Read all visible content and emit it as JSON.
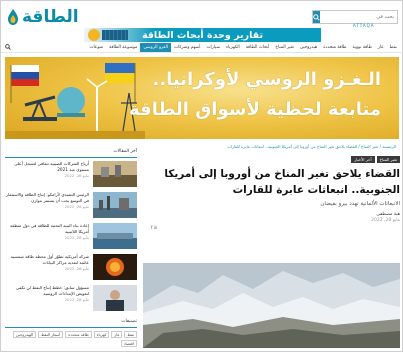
{
  "header": {
    "logo_text": "الطاقة",
    "logo_sub": "ATTAQA",
    "search_placeholder": "بحث في"
  },
  "promo": {
    "text": "تقارير وحدة أبحاث الطاقة"
  },
  "nav": {
    "items": [
      {
        "label": "نفط",
        "active": false
      },
      {
        "label": "غاز",
        "active": false
      },
      {
        "label": "طاقة نووية",
        "active": false
      },
      {
        "label": "طاقة متجددة",
        "active": false
      },
      {
        "label": "هيدروجين",
        "active": false
      },
      {
        "label": "تغير المناخ",
        "active": false
      },
      {
        "label": "أبحاث الطاقة",
        "active": false
      },
      {
        "label": "الكهرباء",
        "active": false
      },
      {
        "label": "سيارات",
        "active": false
      },
      {
        "label": "أسهم وشركات",
        "active": false
      },
      {
        "label": "الغزو الروسي",
        "active": true
      },
      {
        "label": "موسوعة الطاقة",
        "active": false
      },
      {
        "label": "منوعات",
        "active": false
      }
    ]
  },
  "hero": {
    "line1": "الـغـزو الروسي لأوكرانيا..",
    "line2": "متابعة لحظية لأسواق الطاقة"
  },
  "breadcrumb": "الرئيسية / تغير المناخ / القضاء يلاحق تغير المناخ من أوروبا إلى أمريكا الجنوبية.. انبعاثات عابرة للقارات",
  "article": {
    "tags": [
      "تغير المناخ",
      "آخر الأخبار"
    ],
    "title": "القضاء يلاحق تغير المناخ من أوروبا إلى أمريكا الجنوبية.. انبعاثات عابرة للقارات",
    "subtitle": "الانبعاثات الألمانية تهدد بيرو بفيضان",
    "author": "هبة مصطفى",
    "date": "مايو 28, 2022",
    "share": "f  in"
  },
  "sidebar": {
    "heading": "آخر المقالات",
    "items": [
      {
        "title": "أرباح الشركات الصينية تتعافى لتسجل أعلى مستوى منذ 2021",
        "date": "مايو 28, 2022"
      },
      {
        "title": "الرئيس التنفيذي لأرامكو: إنتاج الطاقة والاستثمار في التوسع يجب أن يستمر بتوازن",
        "date": "مايو 28, 2022"
      },
      {
        "title": "إعادة بناء البنية التحتية للطاقة في دول منطقة أمريكا اللاتينية",
        "date": "مايو 28, 2022"
      },
      {
        "title": "شركة أمريكية تطوّر أول محطة طاقة شمسية عائمة لتغذية مراكز البيانات",
        "date": "مايو 28, 2022"
      },
      {
        "title": "مسؤول سابق: خطط إنتاج النفط لن تكفي لتعويض الإمدادات الروسية",
        "date": "مايو 28, 2022"
      }
    ],
    "heading2": "تصنيفات",
    "tags": [
      "نفط",
      "غاز",
      "كهرباء",
      "طاقة متجددة",
      "أسعار النفط",
      "الهيدروجين",
      "اقتصاد"
    ]
  }
}
